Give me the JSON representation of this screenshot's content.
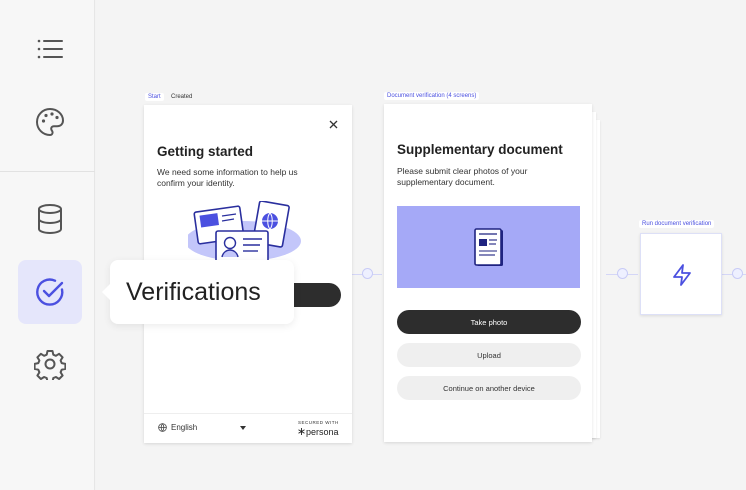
{
  "sidebar": {
    "items": [
      {
        "icon": "list-icon"
      },
      {
        "icon": "palette-icon"
      },
      {
        "icon": "database-icon"
      },
      {
        "icon": "check-circle-icon",
        "active": true
      },
      {
        "icon": "gear-icon"
      }
    ],
    "tooltip": "Verifications"
  },
  "flow": {
    "start_tag": "Start",
    "created_tag": "Created",
    "doc_tag": "Document verification (4 screens)",
    "run_tag": "Run document verification"
  },
  "getting_started": {
    "title": "Getting started",
    "body": "We need some information to help us confirm your identity.",
    "language": "English",
    "secured_with": "SECURED WITH",
    "brand": "persona"
  },
  "supplementary": {
    "title": "Supplementary document",
    "body": "Please submit clear photos of your supplementary document.",
    "take_photo": "Take photo",
    "upload": "Upload",
    "continue_other": "Continue on another device"
  },
  "colors": {
    "accent": "#4b50e0",
    "active_bg": "#e5e6fb",
    "illustration_bg": "#a5a9f7"
  }
}
